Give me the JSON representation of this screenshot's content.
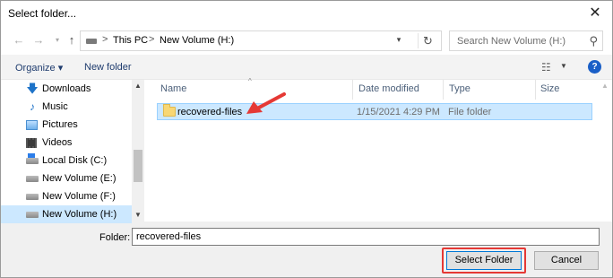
{
  "window": {
    "title": "Select folder..."
  },
  "nav": {
    "back_icon": "arrow-left-icon",
    "forward_icon": "arrow-right-icon",
    "recent_icon": "chevron-down-icon",
    "up_icon": "arrow-up-icon",
    "breadcrumbs": [
      "This PC",
      "New Volume (H:)"
    ],
    "search_placeholder": "Search New Volume (H:)"
  },
  "toolbar": {
    "organize_label": "Organize ▾",
    "new_folder_label": "New folder",
    "help_label": "?"
  },
  "sidebar": {
    "items": [
      {
        "label": "Downloads",
        "icon": "download-icon"
      },
      {
        "label": "Music",
        "icon": "music-icon"
      },
      {
        "label": "Pictures",
        "icon": "pictures-icon"
      },
      {
        "label": "Videos",
        "icon": "videos-icon"
      },
      {
        "label": "Local Disk (C:)",
        "icon": "local-disk-icon"
      },
      {
        "label": "New Volume (E:)",
        "icon": "drive-icon"
      },
      {
        "label": "New Volume (F:)",
        "icon": "drive-icon"
      },
      {
        "label": "New Volume (H:)",
        "icon": "drive-icon",
        "selected": true
      }
    ]
  },
  "filelist": {
    "columns": [
      "Name",
      "Date modified",
      "Type",
      "Size"
    ],
    "rows": [
      {
        "name": "recovered-files",
        "date": "1/15/2021 4:29 PM",
        "type": "File folder",
        "size": "",
        "selected": true
      }
    ]
  },
  "footer": {
    "folder_label": "Folder:",
    "folder_value": "recovered-files",
    "select_button": "Select Folder",
    "cancel_button": "Cancel"
  },
  "colors": {
    "selection": "#cce8ff",
    "annotation": "#e53935",
    "accent": "#0078d7"
  }
}
